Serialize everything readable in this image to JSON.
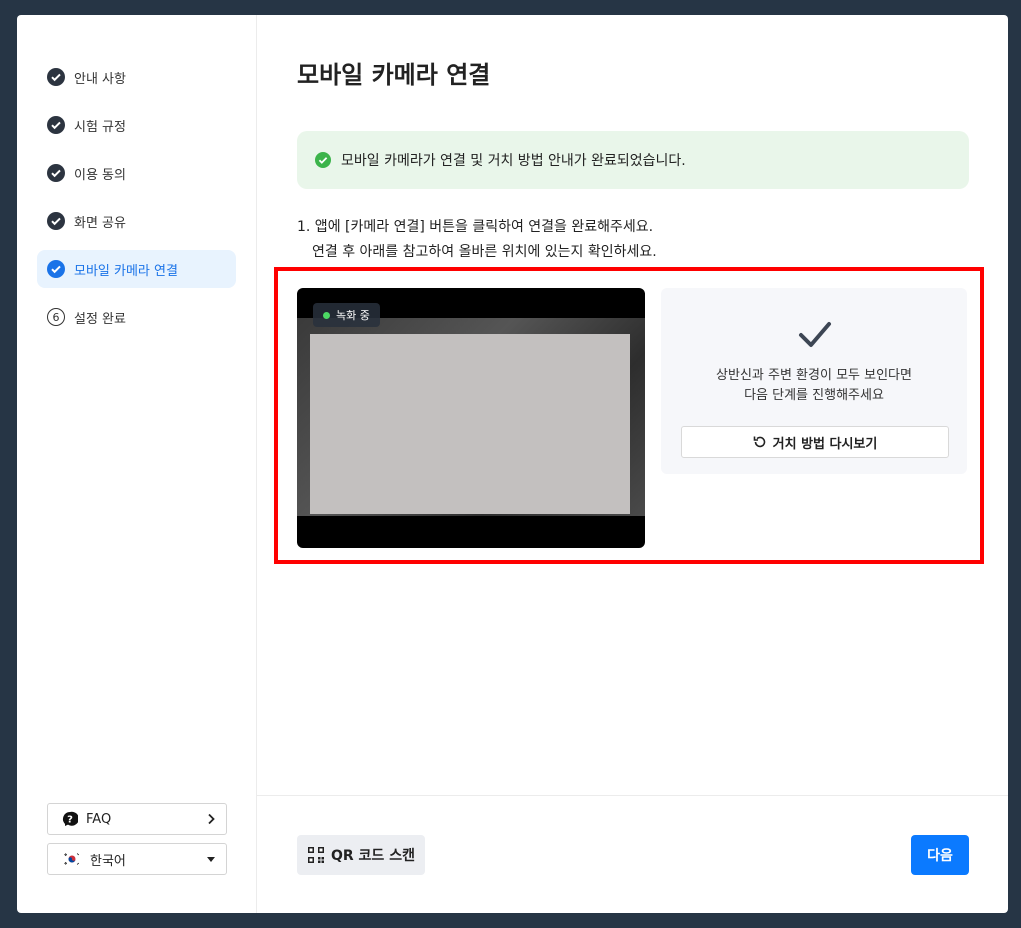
{
  "sidebar": {
    "steps": [
      {
        "label": "안내 사항"
      },
      {
        "label": "시험 규정"
      },
      {
        "label": "이용 동의"
      },
      {
        "label": "화면 공유"
      },
      {
        "label": "모바일 카메라 연결"
      },
      {
        "label": "설정 완료",
        "number": "6"
      }
    ],
    "faq_label": "FAQ",
    "language_label": "한국어"
  },
  "main": {
    "title": "모바일 카메라 연결",
    "success_message": "모바일 카메라가 연결 및 거치 방법 안내가 완료되었습니다.",
    "instruction_line1": "1. 앱에 [카메라 연결] 버튼을 클릭하여 연결을 완료해주세요.",
    "instruction_line2": "연결 후 아래를 참고하여 올바른 위치에 있는지 확인하세요.",
    "recording_badge": "녹화 중",
    "confirm_line1": "상반신과 주변 환경이 모두 보인다면",
    "confirm_line2": "다음 단계를 진행해주세요",
    "review_button": "거치 방법 다시보기",
    "qr_button": "QR 코드 스캔",
    "next_button": "다음"
  },
  "colors": {
    "accent": "#0b7aff",
    "active_step_bg": "#e8f3fe",
    "success_bg": "#e9f6ea",
    "success_icon": "#3cb44b",
    "highlight_border": "#ff0000"
  }
}
